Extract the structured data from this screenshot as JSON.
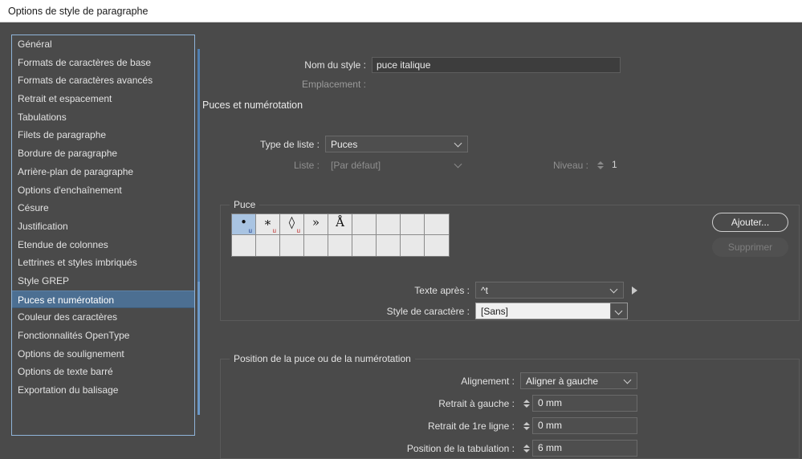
{
  "window": {
    "title": "Options de style de paragraphe"
  },
  "sidebar": {
    "items": [
      {
        "label": "Général",
        "selected": false
      },
      {
        "label": "Formats de caractères de base",
        "selected": false
      },
      {
        "label": "Formats de caractères avancés",
        "selected": false
      },
      {
        "label": "Retrait et espacement",
        "selected": false
      },
      {
        "label": "Tabulations",
        "selected": false
      },
      {
        "label": "Filets de paragraphe",
        "selected": false
      },
      {
        "label": "Bordure de paragraphe",
        "selected": false
      },
      {
        "label": "Arrière-plan de paragraphe",
        "selected": false
      },
      {
        "label": "Options d'enchaînement",
        "selected": false
      },
      {
        "label": "Césure",
        "selected": false
      },
      {
        "label": "Justification",
        "selected": false
      },
      {
        "label": "Etendue de colonnes",
        "selected": false
      },
      {
        "label": "Lettrines et styles imbriqués",
        "selected": false
      },
      {
        "label": "Style GREP",
        "selected": false
      },
      {
        "label": "Puces et numérotation",
        "selected": true
      },
      {
        "label": "Couleur des caractères",
        "selected": false
      },
      {
        "label": "Fonctionnalités OpenType",
        "selected": false
      },
      {
        "label": "Options de soulignement",
        "selected": false
      },
      {
        "label": "Options de texte barré",
        "selected": false
      },
      {
        "label": "Exportation du balisage",
        "selected": false
      }
    ]
  },
  "header": {
    "style_name_label": "Nom du style :",
    "style_name_value": "puce italique",
    "location_label": "Emplacement :",
    "location_value": ""
  },
  "section": {
    "title": "Puces et numérotation",
    "list_type_label": "Type de liste :",
    "list_type_value": "Puces",
    "list_label": "Liste :",
    "list_value": "[Par défaut]",
    "level_label": "Niveau :",
    "level_value": "1"
  },
  "bullet": {
    "legend": "Puce",
    "cells": [
      {
        "glyph": "•",
        "flag": "u",
        "flag_color": "blue",
        "selected": true
      },
      {
        "glyph": "∗",
        "flag": "u",
        "flag_color": "red",
        "selected": false
      },
      {
        "glyph": "◊",
        "flag": "u",
        "flag_color": "red",
        "selected": false
      },
      {
        "glyph": "»",
        "flag": "",
        "flag_color": "",
        "selected": false
      },
      {
        "glyph": "Å",
        "flag": "",
        "flag_color": "",
        "selected": false
      },
      {
        "glyph": "",
        "flag": "",
        "flag_color": "",
        "selected": false
      },
      {
        "glyph": "",
        "flag": "",
        "flag_color": "",
        "selected": false
      },
      {
        "glyph": "",
        "flag": "",
        "flag_color": "",
        "selected": false
      },
      {
        "glyph": "",
        "flag": "",
        "flag_color": "",
        "selected": false
      }
    ],
    "add_button": "Ajouter...",
    "delete_button": "Supprimer",
    "text_after_label": "Texte après :",
    "text_after_value": "^t",
    "char_style_label": "Style de caractère :",
    "char_style_value": "[Sans]"
  },
  "position": {
    "legend": "Position de la puce ou de la numérotation",
    "alignment_label": "Alignement :",
    "alignment_value": "Aligner à gauche",
    "left_indent_label": "Retrait à gauche :",
    "left_indent_value": "0 mm",
    "first_line_indent_label": "Retrait de 1re ligne :",
    "first_line_indent_value": "0 mm",
    "tab_position_label": "Position de la tabulation :",
    "tab_position_value": "6 mm"
  },
  "colors": {
    "background": "#4a4a4a",
    "titlebar": "#ffffff",
    "selection": "#4c6f92",
    "sidebar_border": "#8fb4d9",
    "grid_cell": "#e9e9e9",
    "grid_cell_selected": "#a9c4e2",
    "rail": "#6b98c6"
  }
}
